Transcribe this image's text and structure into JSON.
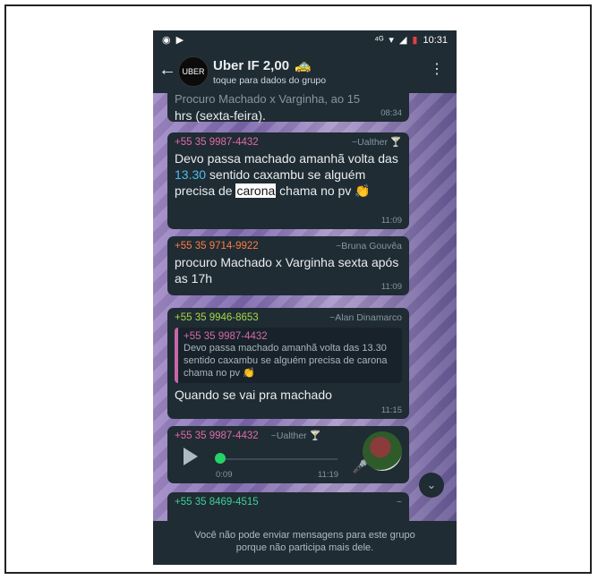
{
  "status_bar": {
    "time": "10:31",
    "left_icons": [
      "notification-icon",
      "video-icon"
    ],
    "right_icons": [
      "signal-4g-icon",
      "wifi-icon",
      "cell-signal-icon",
      "battery-icon"
    ]
  },
  "header": {
    "title": "Uber IF 2,00",
    "subtitle": "toque para dados do grupo",
    "avatar_text": "UBER",
    "title_emoji": "🚕"
  },
  "messages": [
    {
      "text": "hrs (sexta-feira).",
      "top_hidden_text": "Procuro Machado x Varginha, ao 15",
      "time": "08:34"
    },
    {
      "sender": "+55 35 9987-4432",
      "alias": "~Ualther",
      "alias_emoji": "🍸",
      "text_parts": [
        "Devo passa machado amanhã  volta das ",
        "13.30",
        " sentido caxambu se alguém precisa de ",
        "carona",
        " chama no pv "
      ],
      "emoji": "👏",
      "time": "11:09"
    },
    {
      "sender": "+55 35 9714-9922",
      "alias": "~Bruna Gouvêa",
      "text": "procuro Machado x Varginha sexta após as 17h",
      "time": "11:09"
    },
    {
      "sender": "+55 35 9946-8653",
      "alias": "~Alan Dinamarco",
      "quote_sender": "+55 35 9987-4432",
      "quote_text": "Devo passa machado amanhã  volta das 13.30 sentido caxambu se alguém precisa de carona chama no pv 👏",
      "text": "Quando se vai pra machado",
      "time": "11:15"
    },
    {
      "sender": "+55 35 9987-4432",
      "alias": "~Ualther",
      "alias_emoji": "🍸",
      "duration": "0:09",
      "time": "11:19"
    },
    {
      "sender": "+55 35 8469-4515",
      "alias": "~"
    }
  ],
  "footer": {
    "line1": "Você não pode enviar mensagens para este grupo",
    "line2": "porque não participa mais dele."
  },
  "colors": {
    "sender_1": "#e06aa8",
    "sender_2": "#ff7a45",
    "sender_3": "#a7d64b",
    "sender_4": "#3fcf9a",
    "link": "#53bdeb",
    "bubble": "#1f2c33"
  }
}
